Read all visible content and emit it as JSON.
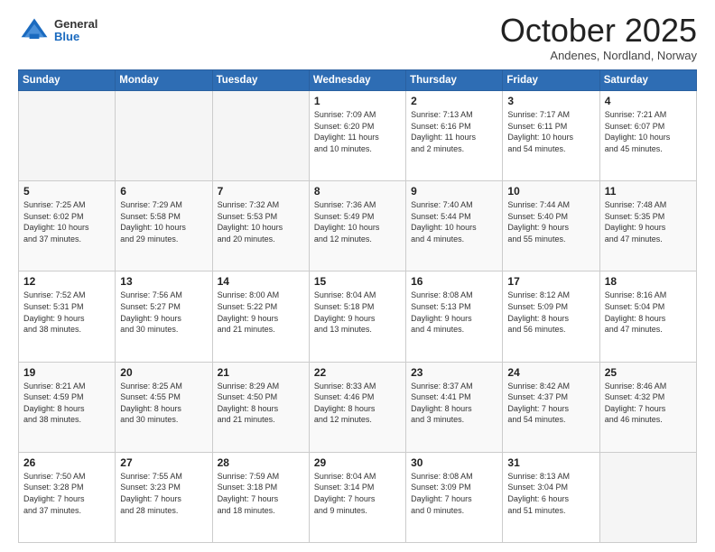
{
  "header": {
    "logo": {
      "general": "General",
      "blue": "Blue"
    },
    "month": "October 2025",
    "location": "Andenes, Nordland, Norway"
  },
  "weekdays": [
    "Sunday",
    "Monday",
    "Tuesday",
    "Wednesday",
    "Thursday",
    "Friday",
    "Saturday"
  ],
  "weeks": [
    [
      {
        "day": "",
        "info": ""
      },
      {
        "day": "",
        "info": ""
      },
      {
        "day": "",
        "info": ""
      },
      {
        "day": "1",
        "info": "Sunrise: 7:09 AM\nSunset: 6:20 PM\nDaylight: 11 hours\nand 10 minutes."
      },
      {
        "day": "2",
        "info": "Sunrise: 7:13 AM\nSunset: 6:16 PM\nDaylight: 11 hours\nand 2 minutes."
      },
      {
        "day": "3",
        "info": "Sunrise: 7:17 AM\nSunset: 6:11 PM\nDaylight: 10 hours\nand 54 minutes."
      },
      {
        "day": "4",
        "info": "Sunrise: 7:21 AM\nSunset: 6:07 PM\nDaylight: 10 hours\nand 45 minutes."
      }
    ],
    [
      {
        "day": "5",
        "info": "Sunrise: 7:25 AM\nSunset: 6:02 PM\nDaylight: 10 hours\nand 37 minutes."
      },
      {
        "day": "6",
        "info": "Sunrise: 7:29 AM\nSunset: 5:58 PM\nDaylight: 10 hours\nand 29 minutes."
      },
      {
        "day": "7",
        "info": "Sunrise: 7:32 AM\nSunset: 5:53 PM\nDaylight: 10 hours\nand 20 minutes."
      },
      {
        "day": "8",
        "info": "Sunrise: 7:36 AM\nSunset: 5:49 PM\nDaylight: 10 hours\nand 12 minutes."
      },
      {
        "day": "9",
        "info": "Sunrise: 7:40 AM\nSunset: 5:44 PM\nDaylight: 10 hours\nand 4 minutes."
      },
      {
        "day": "10",
        "info": "Sunrise: 7:44 AM\nSunset: 5:40 PM\nDaylight: 9 hours\nand 55 minutes."
      },
      {
        "day": "11",
        "info": "Sunrise: 7:48 AM\nSunset: 5:35 PM\nDaylight: 9 hours\nand 47 minutes."
      }
    ],
    [
      {
        "day": "12",
        "info": "Sunrise: 7:52 AM\nSunset: 5:31 PM\nDaylight: 9 hours\nand 38 minutes."
      },
      {
        "day": "13",
        "info": "Sunrise: 7:56 AM\nSunset: 5:27 PM\nDaylight: 9 hours\nand 30 minutes."
      },
      {
        "day": "14",
        "info": "Sunrise: 8:00 AM\nSunset: 5:22 PM\nDaylight: 9 hours\nand 21 minutes."
      },
      {
        "day": "15",
        "info": "Sunrise: 8:04 AM\nSunset: 5:18 PM\nDaylight: 9 hours\nand 13 minutes."
      },
      {
        "day": "16",
        "info": "Sunrise: 8:08 AM\nSunset: 5:13 PM\nDaylight: 9 hours\nand 4 minutes."
      },
      {
        "day": "17",
        "info": "Sunrise: 8:12 AM\nSunset: 5:09 PM\nDaylight: 8 hours\nand 56 minutes."
      },
      {
        "day": "18",
        "info": "Sunrise: 8:16 AM\nSunset: 5:04 PM\nDaylight: 8 hours\nand 47 minutes."
      }
    ],
    [
      {
        "day": "19",
        "info": "Sunrise: 8:21 AM\nSunset: 4:59 PM\nDaylight: 8 hours\nand 38 minutes."
      },
      {
        "day": "20",
        "info": "Sunrise: 8:25 AM\nSunset: 4:55 PM\nDaylight: 8 hours\nand 30 minutes."
      },
      {
        "day": "21",
        "info": "Sunrise: 8:29 AM\nSunset: 4:50 PM\nDaylight: 8 hours\nand 21 minutes."
      },
      {
        "day": "22",
        "info": "Sunrise: 8:33 AM\nSunset: 4:46 PM\nDaylight: 8 hours\nand 12 minutes."
      },
      {
        "day": "23",
        "info": "Sunrise: 8:37 AM\nSunset: 4:41 PM\nDaylight: 8 hours\nand 3 minutes."
      },
      {
        "day": "24",
        "info": "Sunrise: 8:42 AM\nSunset: 4:37 PM\nDaylight: 7 hours\nand 54 minutes."
      },
      {
        "day": "25",
        "info": "Sunrise: 8:46 AM\nSunset: 4:32 PM\nDaylight: 7 hours\nand 46 minutes."
      }
    ],
    [
      {
        "day": "26",
        "info": "Sunrise: 7:50 AM\nSunset: 3:28 PM\nDaylight: 7 hours\nand 37 minutes."
      },
      {
        "day": "27",
        "info": "Sunrise: 7:55 AM\nSunset: 3:23 PM\nDaylight: 7 hours\nand 28 minutes."
      },
      {
        "day": "28",
        "info": "Sunrise: 7:59 AM\nSunset: 3:18 PM\nDaylight: 7 hours\nand 18 minutes."
      },
      {
        "day": "29",
        "info": "Sunrise: 8:04 AM\nSunset: 3:14 PM\nDaylight: 7 hours\nand 9 minutes."
      },
      {
        "day": "30",
        "info": "Sunrise: 8:08 AM\nSunset: 3:09 PM\nDaylight: 7 hours\nand 0 minutes."
      },
      {
        "day": "31",
        "info": "Sunrise: 8:13 AM\nSunset: 3:04 PM\nDaylight: 6 hours\nand 51 minutes."
      },
      {
        "day": "",
        "info": ""
      }
    ]
  ]
}
